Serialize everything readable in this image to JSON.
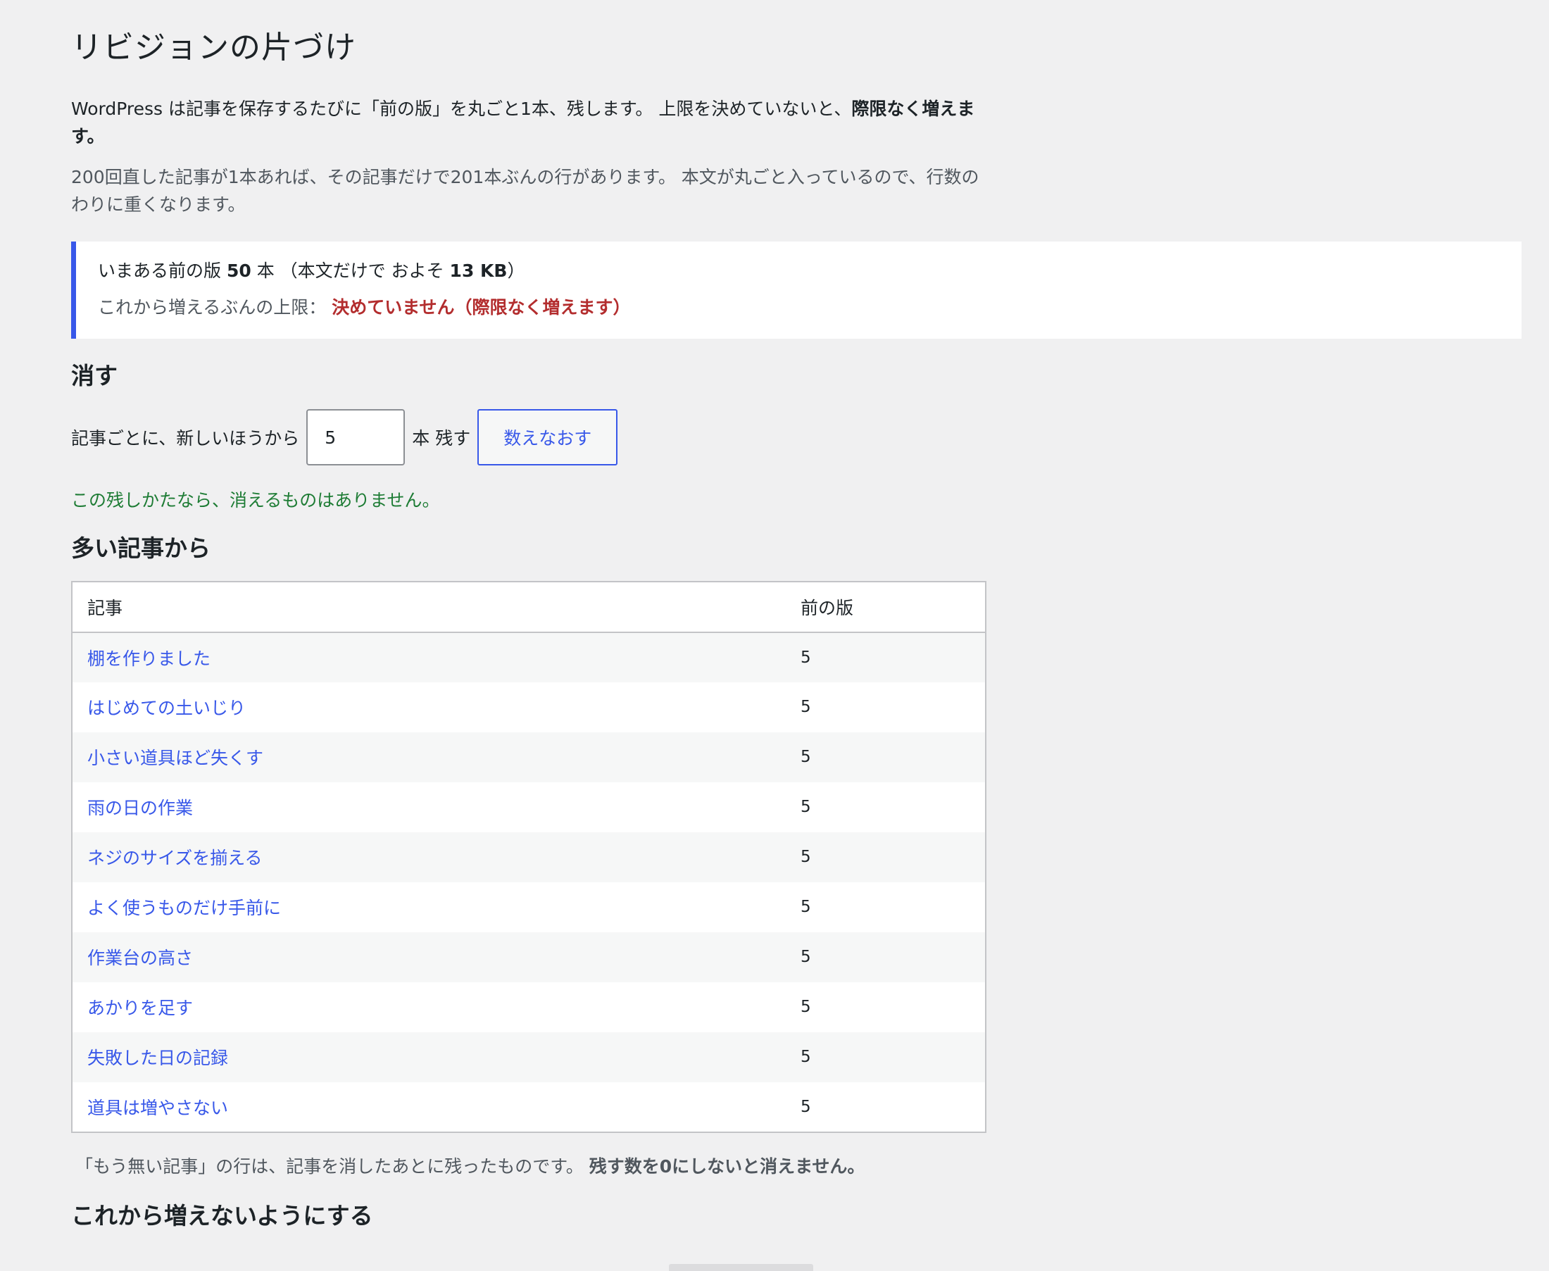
{
  "page": {
    "title": "リビジョンの片づけ"
  },
  "intro": {
    "text": "WordPress は記事を保存するたびに「前の版」を丸ごと1本、残します。 上限を決めていないと、",
    "strong": "際限なく増えます。",
    "detail": "200回直した記事が1本あれば、その記事だけで201本ぶんの行があります。 本文が丸ごと入っているので、行数のわりに重くなります。"
  },
  "notice": {
    "count_prefix": "いまある前の版 ",
    "count_value": "50",
    "count_suffix": " 本 （本文だけで およそ ",
    "size_value": "13 KB",
    "size_suffix": "）",
    "limit_label": "これから増えるぶんの上限：",
    "limit_value": "決めていません（際限なく増えます）"
  },
  "delete_section": {
    "heading": "消す",
    "keep_label": "記事ごとに、新しいほうから",
    "keep_value": "5",
    "keep_unit": "本 残す",
    "recount_button": "数えなおす",
    "result_message": "この残しかたなら、消えるものはありません。"
  },
  "most_section": {
    "heading": "多い記事から",
    "columns": [
      "記事",
      "前の版"
    ],
    "rows": [
      {
        "title": "棚を作りました",
        "count": "5"
      },
      {
        "title": "はじめての土いじり",
        "count": "5"
      },
      {
        "title": "小さい道具ほど失くす",
        "count": "5"
      },
      {
        "title": "雨の日の作業",
        "count": "5"
      },
      {
        "title": "ネジのサイズを揃える",
        "count": "5"
      },
      {
        "title": "よく使うものだけ手前に",
        "count": "5"
      },
      {
        "title": "作業台の高さ",
        "count": "5"
      },
      {
        "title": "あかりを足す",
        "count": "5"
      },
      {
        "title": "失敗した日の記録",
        "count": "5"
      },
      {
        "title": "道具は増やさない",
        "count": "5"
      }
    ],
    "footnote": "「もう無い記事」の行は、記事を消したあとに残ったものです。 ",
    "footnote_strong": "残す数を0にしないと消えません。"
  },
  "stop_section": {
    "heading": "これから増えないようにする"
  },
  "colors": {
    "accent": "#3858e9",
    "warning": "#b32d2e",
    "success": "#1e7c35",
    "background": "#f0f0f1"
  }
}
